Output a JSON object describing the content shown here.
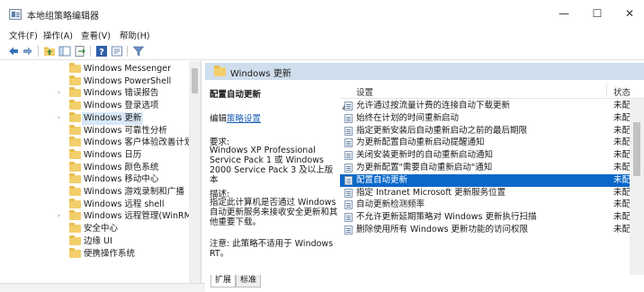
{
  "window": {
    "title": "本地组策略编辑器",
    "minimize_glyph": "—",
    "maximize_glyph": "☐",
    "close_glyph": "✕"
  },
  "menu": [
    "文件(F)",
    "操作(A)",
    "查看(V)",
    "帮助(H)"
  ],
  "toolbar_icons": [
    "back-icon",
    "forward-icon",
    "up-folder-icon",
    "show-hide-tree-icon",
    "export-list-icon",
    "help-icon",
    "properties-icon",
    "filter-icon"
  ],
  "tree": {
    "items": [
      {
        "label": "Windows Messenger",
        "expandable": false,
        "selected": false
      },
      {
        "label": "Windows PowerShell",
        "expandable": false,
        "selected": false
      },
      {
        "label": "Windows 错误报告",
        "expandable": true,
        "selected": false
      },
      {
        "label": "Windows 登录选项",
        "expandable": false,
        "selected": false
      },
      {
        "label": "Windows 更新",
        "expandable": true,
        "selected": true
      },
      {
        "label": "Windows 可靠性分析",
        "expandable": false,
        "selected": false
      },
      {
        "label": "Windows 客户体验改善计划",
        "expandable": false,
        "selected": false
      },
      {
        "label": "Windows 日历",
        "expandable": false,
        "selected": false
      },
      {
        "label": "Windows 颜色系统",
        "expandable": false,
        "selected": false
      },
      {
        "label": "Windows 移动中心",
        "expandable": false,
        "selected": false
      },
      {
        "label": "Windows 游戏录制和广播",
        "expandable": false,
        "selected": false
      },
      {
        "label": "Windows 远程 shell",
        "expandable": false,
        "selected": false
      },
      {
        "label": "Windows 远程管理(WinRM)",
        "expandable": true,
        "selected": false
      },
      {
        "label": "安全中心",
        "expandable": false,
        "selected": false
      },
      {
        "label": "边缘 UI",
        "expandable": false,
        "selected": false
      },
      {
        "label": "便携操作系统",
        "expandable": false,
        "selected": false
      }
    ]
  },
  "right_header": "Windows 更新",
  "description": {
    "title": "配置自动更新",
    "edit_prefix": "编辑",
    "edit_link": "策略设置",
    "requirements_label": "要求:",
    "requirements": "Windows XP Professional Service Pack 1 或 Windows 2000 Service Pack 3 及以上版本",
    "description_label": "描述:",
    "description": "指定此计算机是否通过 Windows 自动更新服务来接收安全更新和其他重要下载。",
    "note": "注意: 此策略不适用于 Windows RT。"
  },
  "list": {
    "col_setting": "设置",
    "col_state": "状态",
    "rows": [
      {
        "name": "允许通过按流量计费的连接自动下载更新",
        "state": "未配置",
        "selected": false
      },
      {
        "name": "始终在计划的时间重新启动",
        "state": "未配置",
        "selected": false
      },
      {
        "name": "指定更新安装后自动重新启动之前的最后期限",
        "state": "未配置",
        "selected": false
      },
      {
        "name": "为更新配置自动重新启动提醒通知",
        "state": "未配置",
        "selected": false
      },
      {
        "name": "关闭安装更新时的自动重新启动通知",
        "state": "未配置",
        "selected": false
      },
      {
        "name": "为更新配置\"需要自动重新启动\"通知",
        "state": "未配置",
        "selected": false
      },
      {
        "name": "配置自动更新",
        "state": "未配置",
        "selected": true
      },
      {
        "name": "指定 Intranet Microsoft 更新服务位置",
        "state": "未配置",
        "selected": false
      },
      {
        "name": "自动更新检测频率",
        "state": "未配置",
        "selected": false
      },
      {
        "name": "不允许更新延期策略对 Windows 更新执行扫描",
        "state": "未配置",
        "selected": false
      },
      {
        "name": "删除使用所有 Windows 更新功能的访问权限",
        "state": "未配置",
        "selected": false
      }
    ]
  },
  "tabs": [
    "扩展",
    "标准"
  ]
}
